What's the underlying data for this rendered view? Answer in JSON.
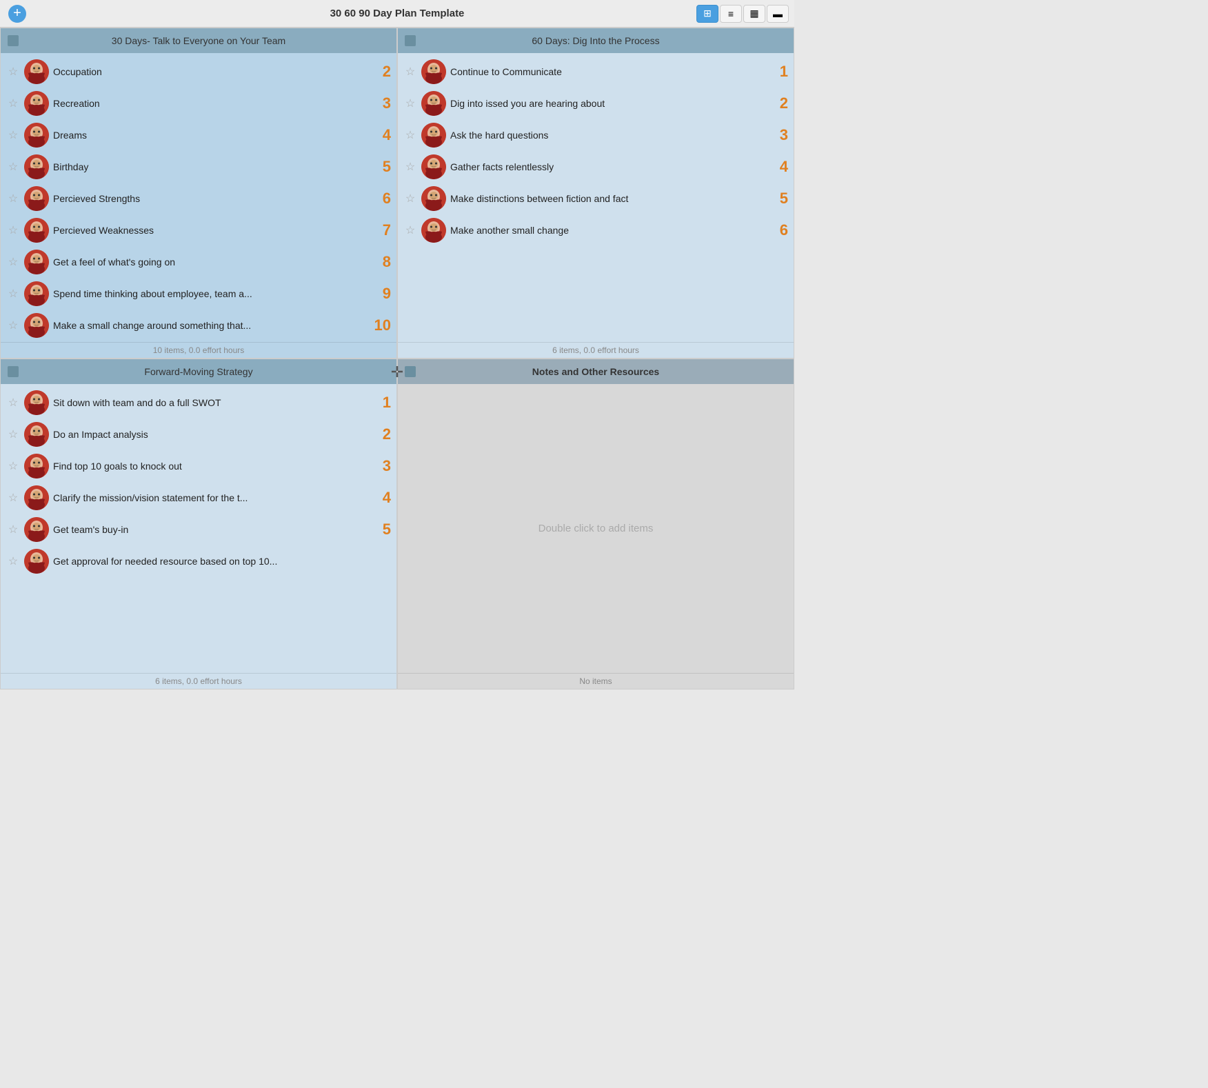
{
  "titleBar": {
    "title": "30 60 90 Day Plan Template",
    "addLabel": "+",
    "controls": [
      {
        "label": "⊞",
        "active": true,
        "name": "grid-view"
      },
      {
        "label": "≡",
        "active": false,
        "name": "list-view"
      },
      {
        "label": "📅",
        "active": false,
        "name": "calendar-view"
      },
      {
        "label": "📊",
        "active": false,
        "name": "chart-view"
      }
    ]
  },
  "quadrants": [
    {
      "id": "q1",
      "header": "30 Days- Talk to Everyone on Your Team",
      "bold": false,
      "items": [
        {
          "text": "Occupation",
          "number": "2"
        },
        {
          "text": "Recreation",
          "number": "3"
        },
        {
          "text": "Dreams",
          "number": "4"
        },
        {
          "text": "Birthday",
          "number": "5"
        },
        {
          "text": "Percieved Strengths",
          "number": "6"
        },
        {
          "text": "Percieved Weaknesses",
          "number": "7"
        },
        {
          "text": "Get a feel of what's going on",
          "number": "8"
        },
        {
          "text": "Spend time thinking about employee, team a...",
          "number": "9"
        },
        {
          "text": "Make a small change around something that...",
          "number": "10"
        }
      ],
      "footer": "10 items, 0.0 effort hours"
    },
    {
      "id": "q2",
      "header": "60 Days: Dig Into the Process",
      "bold": false,
      "items": [
        {
          "text": "Continue to Communicate",
          "number": "1"
        },
        {
          "text": "Dig into issed you are hearing about",
          "number": "2"
        },
        {
          "text": "Ask the hard questions",
          "number": "3"
        },
        {
          "text": "Gather facts relentlessly",
          "number": "4"
        },
        {
          "text": "Make distinctions between fiction and fact",
          "number": "5"
        },
        {
          "text": "Make another small change",
          "number": "6"
        }
      ],
      "footer": "6 items, 0.0 effort hours"
    },
    {
      "id": "q3",
      "header": "Forward-Moving Strategy",
      "bold": false,
      "items": [
        {
          "text": "Sit down with team and do a full SWOT",
          "number": "1"
        },
        {
          "text": "Do an Impact analysis",
          "number": "2"
        },
        {
          "text": "Find top 10 goals to knock out",
          "number": "3"
        },
        {
          "text": "Clarify the mission/vision statement for the t...",
          "number": "4"
        },
        {
          "text": "Get team's buy-in",
          "number": "5"
        },
        {
          "text": "Get approval for needed resource based on top 10...",
          "number": ""
        }
      ],
      "footer": "6 items, 0.0 effort hours"
    },
    {
      "id": "q4",
      "header": "Notes and Other Resources",
      "bold": true,
      "items": [],
      "emptyMessage": "Double click to add items",
      "footer": "No items"
    }
  ],
  "divider": "✛"
}
